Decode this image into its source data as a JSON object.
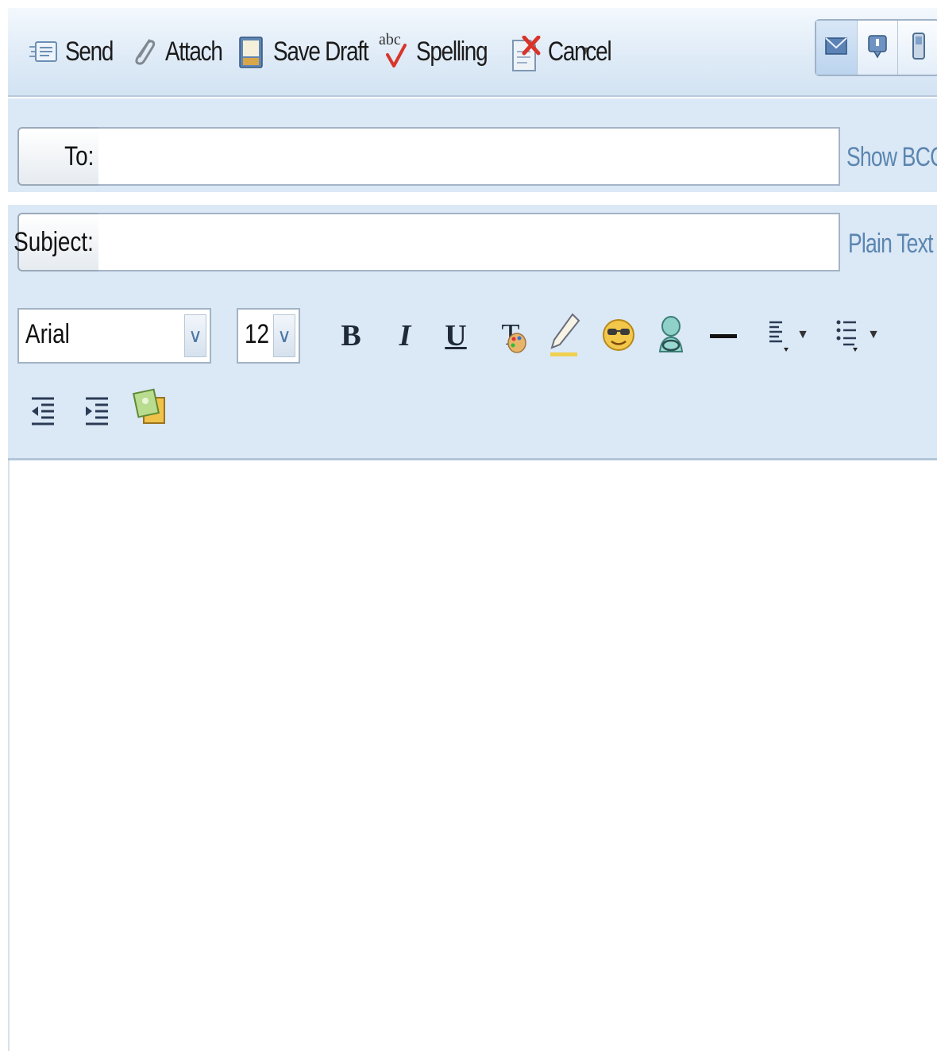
{
  "toolbar": {
    "send_label": "Send",
    "attach_label": "Attach",
    "save_draft_label": "Save Draft",
    "spelling_label": "Spelling",
    "spelling_icon_text": "abc",
    "cancel_label": "Cancel"
  },
  "view_modes": [
    {
      "icon": "envelope-icon",
      "active": true
    },
    {
      "icon": "speech-bubble-icon",
      "active": false
    },
    {
      "icon": "mobile-phone-icon",
      "active": false
    }
  ],
  "compose": {
    "to_label": "To:",
    "to_value": "",
    "show_bcc_label": "Show BCC",
    "subject_label": "Subject:",
    "subject_value": "",
    "plain_text_label": "Plain Text"
  },
  "format": {
    "font_family": "Arial",
    "font_size": "12",
    "bold_label": "B",
    "italic_label": "I",
    "underline_label": "U",
    "text_color_label": "T"
  },
  "colors": {
    "toolbar_bg": "#dfebf7",
    "panel_bg": "#dbe8f6",
    "link": "#5b86b0"
  }
}
